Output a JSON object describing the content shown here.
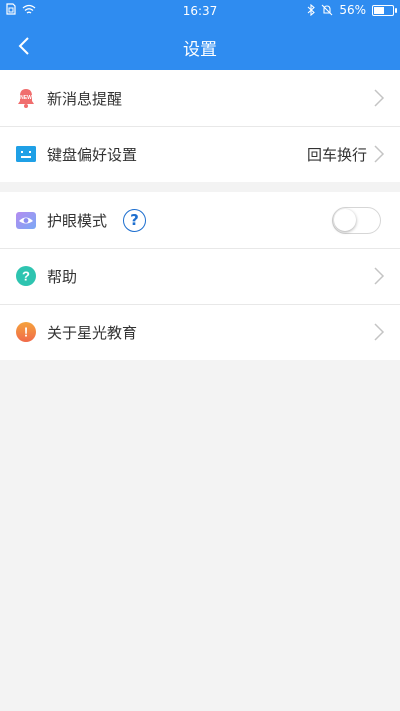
{
  "status_bar": {
    "time": "16:37",
    "battery_text": "56%",
    "battery_level": 0.56,
    "icons": [
      "sim-icon",
      "wifi-icon",
      "bluetooth-icon",
      "mute-icon",
      "battery-icon"
    ]
  },
  "header": {
    "title": "设置",
    "back_icon": "back-arrow-icon",
    "background_color": "#2f8cf0"
  },
  "settings": {
    "new_message": {
      "label": "新消息提醒",
      "icon": "bell-icon",
      "badge_text": "NEW"
    },
    "keyboard": {
      "label": "键盘偏好设置",
      "value": "回车换行",
      "icon": "keyboard-icon"
    },
    "eye_care": {
      "label": "护眼模式",
      "help_symbol": "?",
      "toggle_on": false,
      "icon": "eye-icon"
    },
    "help": {
      "label": "帮助",
      "icon": "question-icon",
      "symbol": "?"
    },
    "about": {
      "label": "关于星光教育",
      "icon": "info-icon",
      "symbol": "!"
    }
  }
}
